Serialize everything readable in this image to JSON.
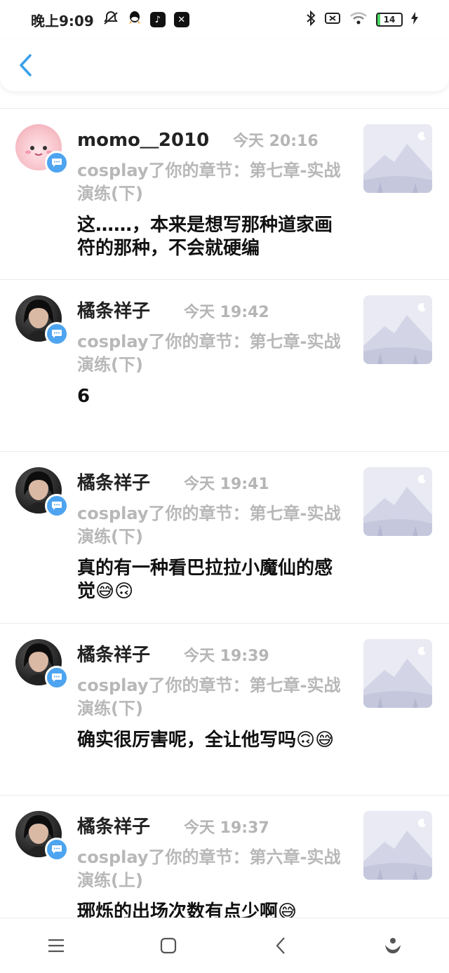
{
  "status": {
    "time": "晚上9:09",
    "battery": "14"
  },
  "header": {
    "back_label": ""
  },
  "items": [
    {
      "username": "momo＿2010",
      "time": "今天  20:16",
      "reference": "cosplay了你的章节：第七章-实战演练(下)",
      "comment": "这……，本来是想写那种道家画符的那种，不会就硬编",
      "avatar_style": "pink"
    },
    {
      "username": "橘条祥子",
      "time": "今天  19:42",
      "reference": "cosplay了你的章节：第七章-实战演练(下)",
      "comment": "6",
      "avatar_style": "dark"
    },
    {
      "username": "橘条祥子",
      "time": "今天  19:41",
      "reference": "cosplay了你的章节：第七章-实战演练(下)",
      "comment": "真的有一种看巴拉拉小魔仙的感觉😅🙃",
      "avatar_style": "dark"
    },
    {
      "username": "橘条祥子",
      "time": "今天  19:39",
      "reference": "cosplay了你的章节：第七章-实战演练(下)",
      "comment": "确实很厉害呢，全让他写吗🙃😅",
      "avatar_style": "dark"
    },
    {
      "username": "橘条祥子",
      "time": "今天  19:37",
      "reference": "cosplay了你的章节：第六章-实战演练(上)",
      "comment": "琊烁的出场次数有点少啊😅",
      "avatar_style": "dark"
    }
  ],
  "colors": {
    "accent": "#4da4f0",
    "meta_text": "#b5b5b5",
    "thumb_bg": "#e9eaf3"
  },
  "icons": {
    "back": "chevron-left-icon",
    "badge": "comment-bubble-icon",
    "thumb": "mountain-placeholder-icon",
    "nav": [
      "menu-icon",
      "home-square-icon",
      "back-triangle-icon",
      "assistant-icon"
    ]
  }
}
